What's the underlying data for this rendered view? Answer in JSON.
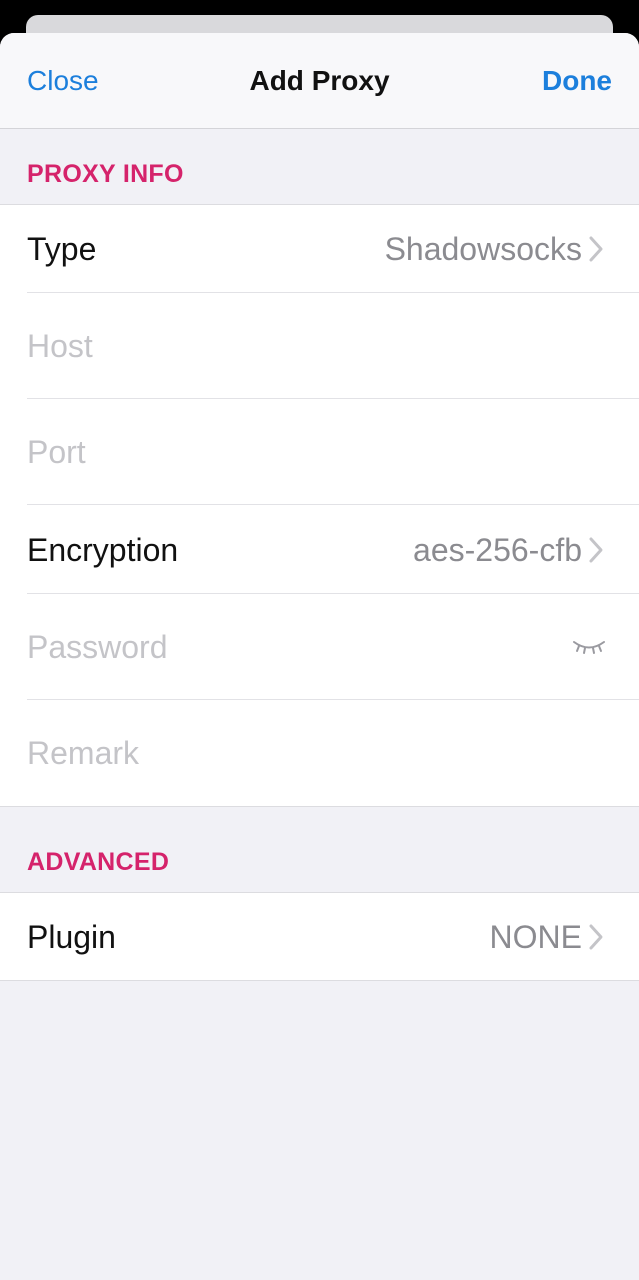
{
  "nav": {
    "close_label": "Close",
    "title": "Add Proxy",
    "done_label": "Done"
  },
  "sections": {
    "proxy_info_header": "PROXY INFO",
    "advanced_header": "ADVANCED"
  },
  "proxy_info": {
    "type": {
      "label": "Type",
      "value": "Shadowsocks"
    },
    "host": {
      "placeholder": "Host",
      "value": ""
    },
    "port": {
      "placeholder": "Port",
      "value": ""
    },
    "encryption": {
      "label": "Encryption",
      "value": "aes-256-cfb"
    },
    "password": {
      "placeholder": "Password",
      "value": ""
    },
    "remark": {
      "placeholder": "Remark",
      "value": ""
    }
  },
  "advanced": {
    "plugin": {
      "label": "Plugin",
      "value": "NONE"
    }
  },
  "colors": {
    "accent": "#1c7fdc",
    "section_header": "#d5236b",
    "grouped_background": "#f1f1f6"
  },
  "icons": {
    "chevron": "chevron-right-icon",
    "password_visibility": "eye-closed-icon"
  }
}
